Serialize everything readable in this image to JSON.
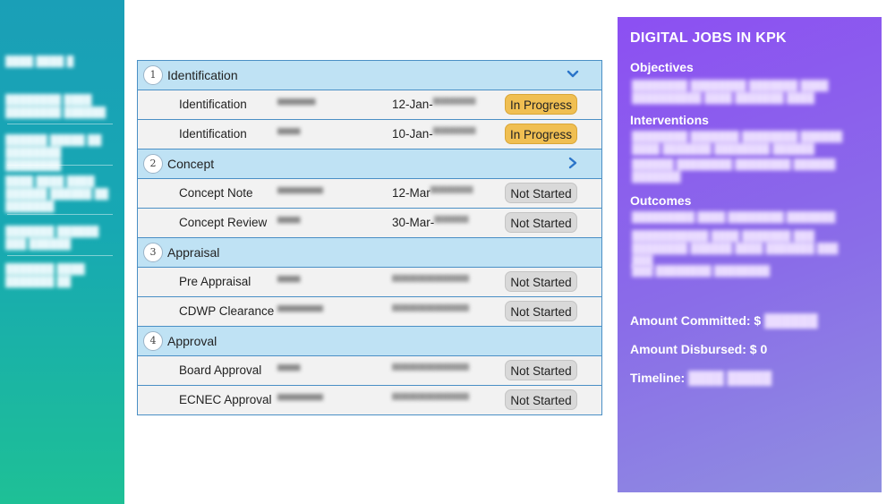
{
  "sidebar": {
    "items": [
      {
        "label": "████ ████ █"
      },
      {
        "label": "████████ ████ ████████ ██████"
      },
      {
        "label": "██████ █████ ██ ████████ ████████"
      },
      {
        "label": "████ ████ ████ ██████ ██████ ██ ███████"
      },
      {
        "label": "███████ ██████ ███ ██████"
      },
      {
        "label": "███████ ████ ███████ ██"
      }
    ]
  },
  "steps": {
    "stages": [
      {
        "number": "1",
        "title": "Identification",
        "chevron": "chevron-down",
        "tasks": [
          {
            "name": "Identification",
            "owner": "▀▀▀▀▀",
            "date": "12-Jan-",
            "date_hidden": "▀▀▀▀▀",
            "status": "In Progress",
            "status_kind": "progress"
          },
          {
            "name": "Identification",
            "owner": "▀▀▀",
            "date": "10-Jan-",
            "date_hidden": "▀▀▀▀▀",
            "status": "In Progress",
            "status_kind": "progress"
          }
        ]
      },
      {
        "number": "2",
        "title": "Concept",
        "chevron": "chevron-right",
        "tasks": [
          {
            "name": "Concept Note",
            "owner": "▀▀▀▀▀▀",
            "date": "12-Mar",
            "date_hidden": "▀▀▀▀▀",
            "status": "Not Started",
            "status_kind": "notstarted"
          },
          {
            "name": "Concept Review",
            "owner": "▀▀▀",
            "date": "30-Mar-",
            "date_hidden": "▀▀▀▀",
            "status": "Not Started",
            "status_kind": "notstarted"
          }
        ]
      },
      {
        "number": "3",
        "title": "Appraisal",
        "chevron": "",
        "tasks": [
          {
            "name": "Pre Appraisal",
            "owner": "▀▀▀",
            "date": "",
            "date_hidden": "▀▀▀▀▀▀▀▀▀",
            "status": "Not Started",
            "status_kind": "notstarted"
          },
          {
            "name": "CDWP Clearance",
            "owner": "▀▀▀▀▀▀",
            "date": "",
            "date_hidden": "▀▀▀▀▀▀▀▀▀",
            "status": "Not Started",
            "status_kind": "notstarted"
          }
        ]
      },
      {
        "number": "4",
        "title": "Approval",
        "chevron": "",
        "tasks": [
          {
            "name": "Board Approval",
            "owner": "▀▀▀",
            "date": "",
            "date_hidden": "▀▀▀▀▀▀▀▀▀",
            "status": "Not Started",
            "status_kind": "notstarted"
          },
          {
            "name": "ECNEC Approval",
            "owner": "▀▀▀▀▀▀",
            "date": "",
            "date_hidden": "▀▀▀▀▀▀▀▀▀",
            "status": "Not Started",
            "status_kind": "notstarted"
          }
        ]
      }
    ]
  },
  "panel": {
    "title": "DIGITAL JOBS IN KPK",
    "objectives_label": "Objectives",
    "objectives_text": "████████ ████████ ███████ ████ ██████████ ████ ███████ ████",
    "interventions_label": "Interventions",
    "interventions_text_1": "████████ ███████ ████████ ██████ ████ ███████ ████████ ██████",
    "interventions_text_2": "██████ ████████ ████████ ██████ ███████",
    "outcomes_label": "Outcomes",
    "outcomes_text_1": "█████████ ████ ████████ ███████",
    "outcomes_text_2": "███████████ ████ ███████ ███ ████████ ██████ ████ ███████ ███ ███",
    "outcomes_text_3": "███ ████████ ████████",
    "amount_committed_label": "Amount Committed: $",
    "amount_committed_value": "██████",
    "amount_disbursed_label": "Amount Disbursed: $ 0",
    "timeline_label": "Timeline:",
    "timeline_value": "████ █████"
  },
  "colors": {
    "sidebar_top": "#1a9fb7",
    "sidebar_bottom": "#1ec096",
    "panel_top": "#8c4ff2",
    "panel_bottom": "#8f8fe0",
    "stage_header": "#bfe2f4",
    "table_border": "#4a8fc5",
    "badge_in_progress": "#f0bf52",
    "badge_not_started": "#d9d9d9",
    "chevron": "#2a74c9"
  }
}
